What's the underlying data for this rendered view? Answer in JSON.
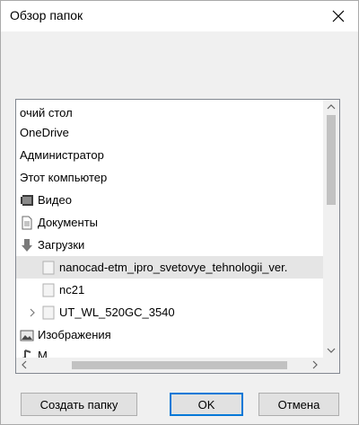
{
  "dialog": {
    "title": "Обзор папок",
    "close_icon": "close-icon"
  },
  "tree": {
    "items": [
      {
        "label": "очий стол",
        "icon": "none"
      },
      {
        "label": "OneDrive",
        "icon": "none"
      },
      {
        "label": "Администратор",
        "icon": "none"
      },
      {
        "label": "Этот компьютер",
        "icon": "none"
      },
      {
        "label": "Видео",
        "icon": "video-folder-icon"
      },
      {
        "label": "Документы",
        "icon": "documents-folder-icon"
      },
      {
        "label": "Загрузки",
        "icon": "downloads-folder-icon"
      },
      {
        "label": "nanocad-etm_ipro_svetovye_tehnologii_ver.",
        "icon": "folder-icon"
      },
      {
        "label": "nc21",
        "icon": "folder-icon"
      },
      {
        "label": "UT_WL_520GC_3540",
        "icon": "folder-icon"
      },
      {
        "label": "Изображения",
        "icon": "pictures-folder-icon"
      },
      {
        "label": "М...",
        "icon": "music-folder-icon"
      }
    ]
  },
  "buttons": {
    "new_folder": "Создать папку",
    "ok": "OK",
    "cancel": "Отмена"
  },
  "colors": {
    "selection": "#e5e5e5",
    "default_button_border": "#0078d7",
    "tree_border": "#828790"
  }
}
